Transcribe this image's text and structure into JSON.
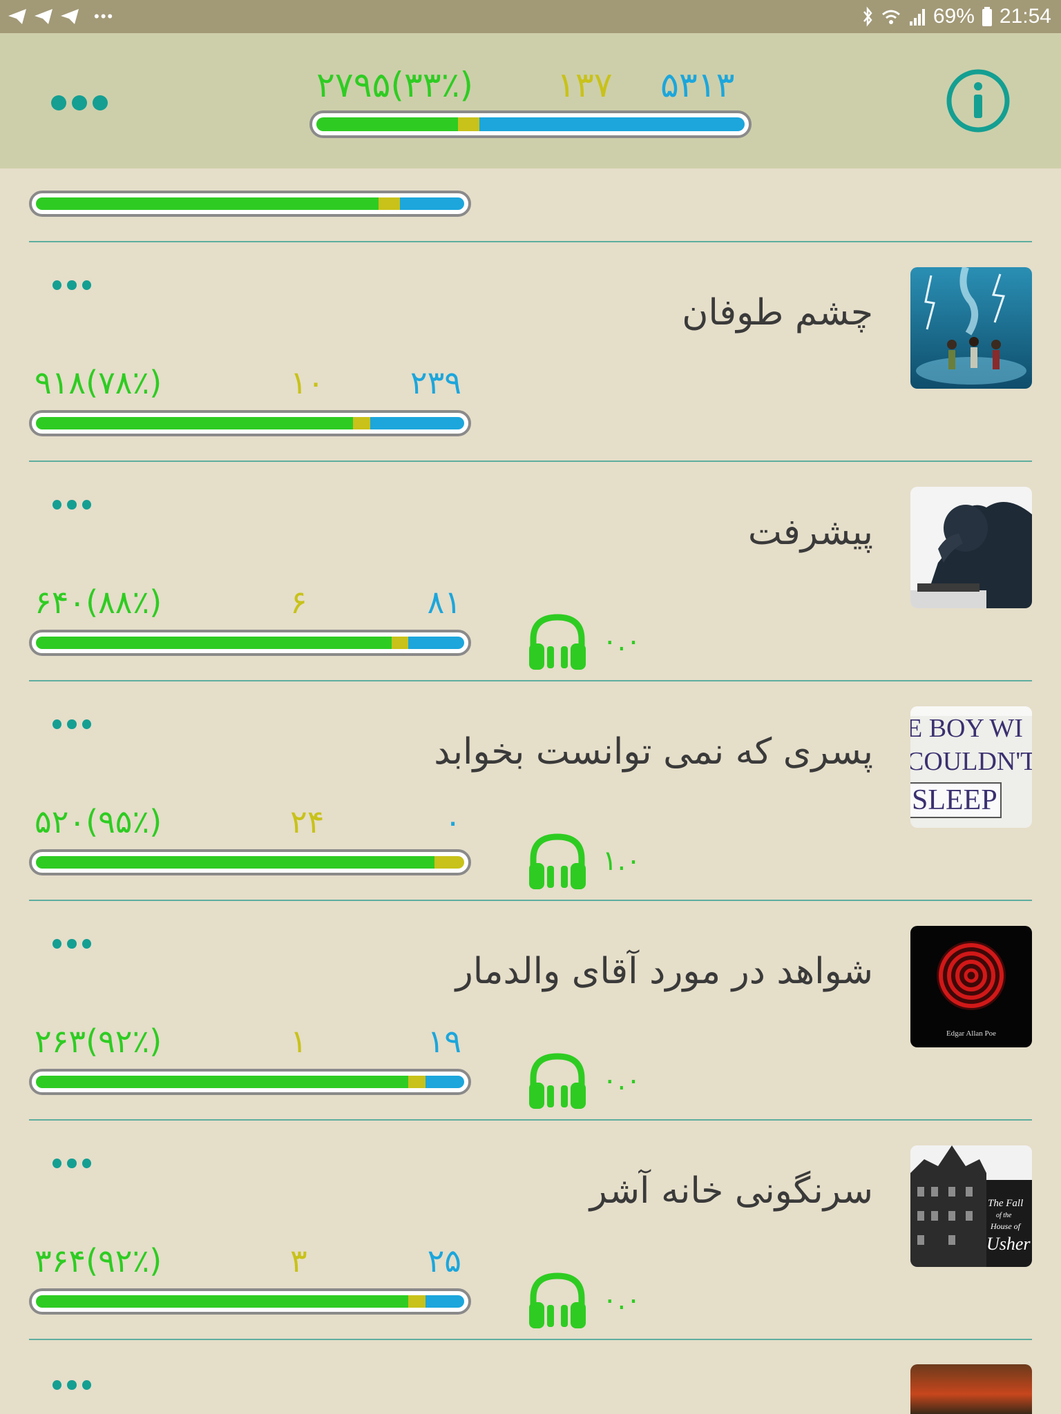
{
  "status_bar": {
    "battery": "69%",
    "time": "21:54",
    "left_icons": [
      "telegram-icon",
      "telegram-icon",
      "telegram-icon"
    ],
    "right_icons": [
      "bluetooth-icon",
      "wifi-icon",
      "signal-icon",
      "battery-icon"
    ]
  },
  "header": {
    "menu_icon": "more-dots-icon",
    "info_icon": "info-icon",
    "stats": {
      "learned": "۲۷۹۵(۳۳٪)",
      "review": "۱۳۷",
      "new": "۵۳۱۳"
    },
    "progress": {
      "green": 0.33,
      "yellow": 0.05,
      "blue": 0.62
    }
  },
  "top_partial_progress": {
    "green": 0.8,
    "yellow": 0.05,
    "blue": 0.15
  },
  "colors": {
    "accent": "#149f92",
    "green": "#2ecc22",
    "yellow": "#c8c21a",
    "blue": "#1ca6dc"
  },
  "books": [
    {
      "title": "چشم طوفان",
      "learned": "۹۱۸(۷۸٪)",
      "review": "۱۰",
      "new": "۲۳۹",
      "progress": {
        "green": 0.74,
        "yellow": 0.04,
        "blue": 0.22
      },
      "audio": null,
      "thumb": "storm"
    },
    {
      "title": "پیشرفت",
      "learned": "۶۴۰(۸۸٪)",
      "review": "۶",
      "new": "۸۱",
      "progress": {
        "green": 0.83,
        "yellow": 0.04,
        "blue": 0.13
      },
      "audio": "۰.۰",
      "thumb": "person"
    },
    {
      "title": "پسری که نمی توانست بخوابد",
      "learned": "۵۲۰(۹۵٪)",
      "review": "۲۴",
      "new": "۰",
      "progress": {
        "green": 0.93,
        "yellow": 0.07,
        "blue": 0.0
      },
      "audio": "۱.۰",
      "thumb": "sleep",
      "thumb_text": [
        "E BOY WI",
        "COULDN'T",
        "SLEEP"
      ]
    },
    {
      "title": "شواهد در مورد آقای والدمار",
      "learned": "۲۶۳(۹۲٪)",
      "review": "۱",
      "new": "۱۹",
      "progress": {
        "green": 0.87,
        "yellow": 0.04,
        "blue": 0.09
      },
      "audio": "۰.۰",
      "thumb": "spiral",
      "thumb_text": [
        "Edgar Allan Poe"
      ]
    },
    {
      "title": "سرنگونی خانه آشر",
      "learned": "۳۶۴(۹۲٪)",
      "review": "۳",
      "new": "۲۵",
      "progress": {
        "green": 0.87,
        "yellow": 0.04,
        "blue": 0.09
      },
      "audio": "۰.۰",
      "thumb": "usher",
      "thumb_text": [
        "The Fall",
        "of the",
        "House of",
        "Usher"
      ]
    }
  ]
}
